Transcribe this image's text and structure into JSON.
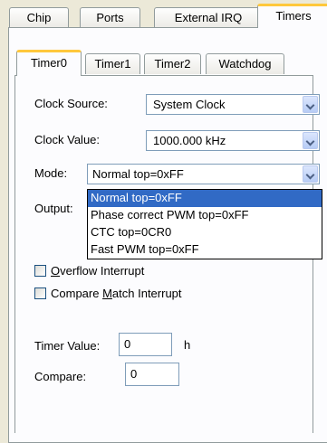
{
  "outer_tabs": [
    "Chip",
    "Ports",
    "External IRQ",
    "Timers"
  ],
  "inner_tabs": [
    "Timer0",
    "Timer1",
    "Timer2",
    "Watchdog"
  ],
  "form": {
    "clock_source_label": "Clock Source:",
    "clock_source_value": "System Clock",
    "clock_value_label": "Clock Value:",
    "clock_value_value": "1000.000 kHz",
    "mode_label": "Mode:",
    "mode_value": "Normal top=0xFF",
    "output_label": "Output:",
    "mode_options": [
      "Normal top=0xFF",
      "Phase correct PWM top=0xFF",
      "CTC top=0CR0",
      "Fast PWM top=0xFF"
    ],
    "overflow_interrupt": {
      "pre": "",
      "accel": "O",
      "post": "verflow Interrupt"
    },
    "compare_match_interrupt": {
      "pre": "Compare ",
      "accel": "M",
      "post": "atch Interrupt"
    },
    "timer_value_label": "Timer Value:",
    "timer_value": "0",
    "timer_value_unit": "h",
    "compare_label": "Compare:",
    "compare_value": "0"
  }
}
